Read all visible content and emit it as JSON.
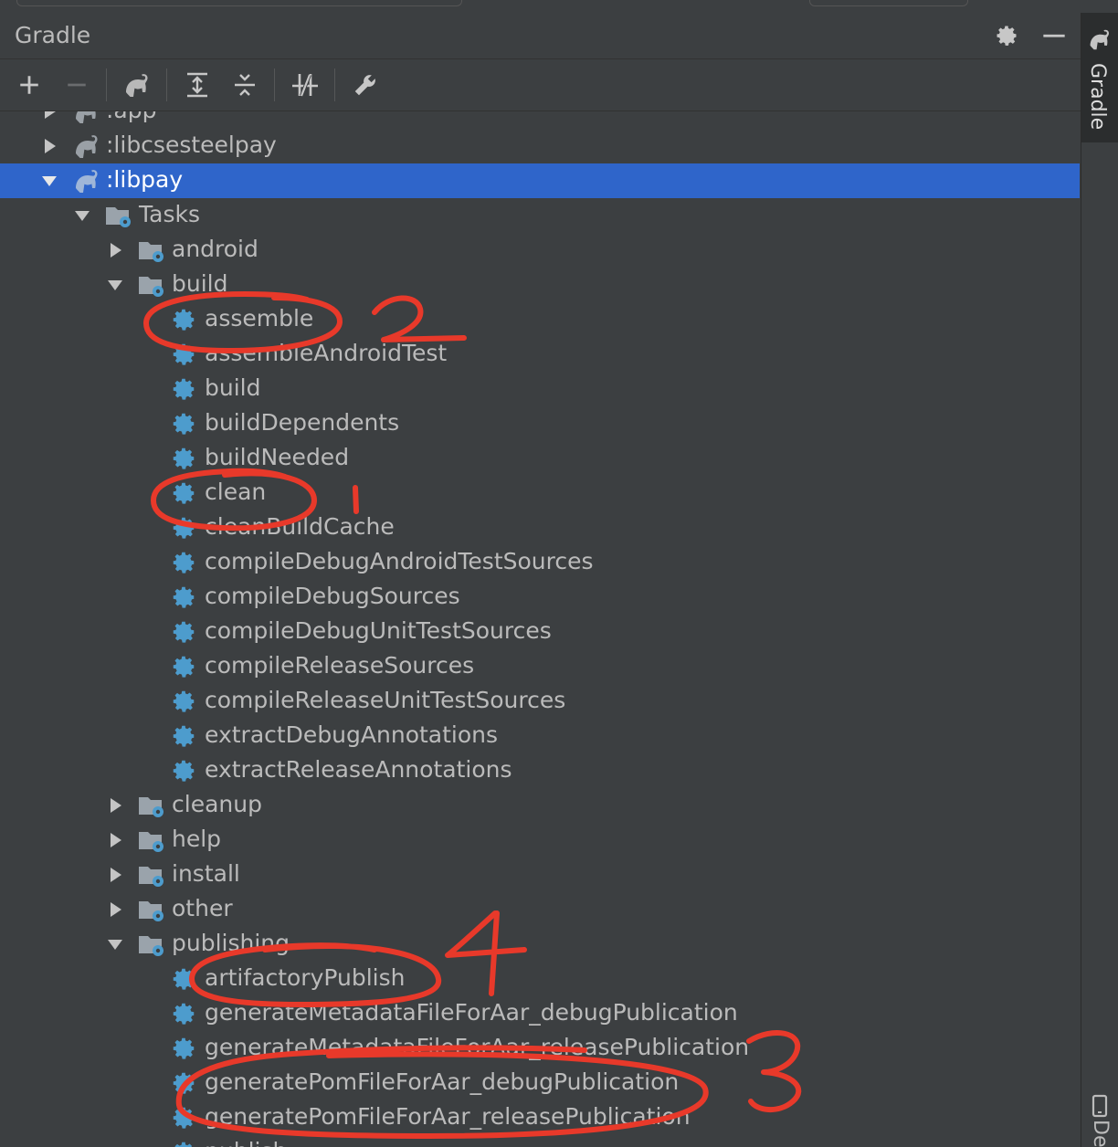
{
  "panel": {
    "title": "Gradle"
  },
  "sidebar": {
    "gradle_tab": "Gradle",
    "bottom_tab": "De"
  },
  "tree": {
    "rows": [
      {
        "label": ":app",
        "level": 0,
        "expanded": false
      },
      {
        "label": ":libcsesteelpay",
        "level": 0,
        "expanded": false
      },
      {
        "label": ":libpay",
        "level": 0,
        "expanded": true,
        "selected": true
      },
      {
        "label": "Tasks",
        "level": 1,
        "expanded": true
      },
      {
        "label": "android",
        "level": 2,
        "expanded": false
      },
      {
        "label": "build",
        "level": 2,
        "expanded": true
      },
      {
        "label": "assemble",
        "level": 3
      },
      {
        "label": "assembleAndroidTest",
        "level": 3
      },
      {
        "label": "build",
        "level": 3
      },
      {
        "label": "buildDependents",
        "level": 3
      },
      {
        "label": "buildNeeded",
        "level": 3
      },
      {
        "label": "clean",
        "level": 3
      },
      {
        "label": "cleanBuildCache",
        "level": 3
      },
      {
        "label": "compileDebugAndroidTestSources",
        "level": 3
      },
      {
        "label": "compileDebugSources",
        "level": 3
      },
      {
        "label": "compileDebugUnitTestSources",
        "level": 3
      },
      {
        "label": "compileReleaseSources",
        "level": 3
      },
      {
        "label": "compileReleaseUnitTestSources",
        "level": 3
      },
      {
        "label": "extractDebugAnnotations",
        "level": 3
      },
      {
        "label": "extractReleaseAnnotations",
        "level": 3
      },
      {
        "label": "cleanup",
        "level": 2,
        "expanded": false
      },
      {
        "label": "help",
        "level": 2,
        "expanded": false
      },
      {
        "label": "install",
        "level": 2,
        "expanded": false
      },
      {
        "label": "other",
        "level": 2,
        "expanded": false
      },
      {
        "label": "publishing",
        "level": 2,
        "expanded": true
      },
      {
        "label": "artifactoryPublish",
        "level": 3
      },
      {
        "label": "generateMetadataFileForAar_debugPublication",
        "level": 3
      },
      {
        "label": "generateMetadataFileForAar_releasePublication",
        "level": 3
      },
      {
        "label": "generatePomFileForAar_debugPublication",
        "level": 3
      },
      {
        "label": "generatePomFileForAar_releasePublication",
        "level": 3
      },
      {
        "label": "publish",
        "level": 3
      }
    ]
  },
  "annotations": {
    "n1": "1",
    "n2": "2",
    "n3": "3",
    "n4": "4",
    "color": "#e8392a"
  },
  "colors": {
    "background": "#3c3f41",
    "selection": "#2f65ca",
    "gear": "#4d9ccd",
    "text": "#bbbbbb"
  }
}
